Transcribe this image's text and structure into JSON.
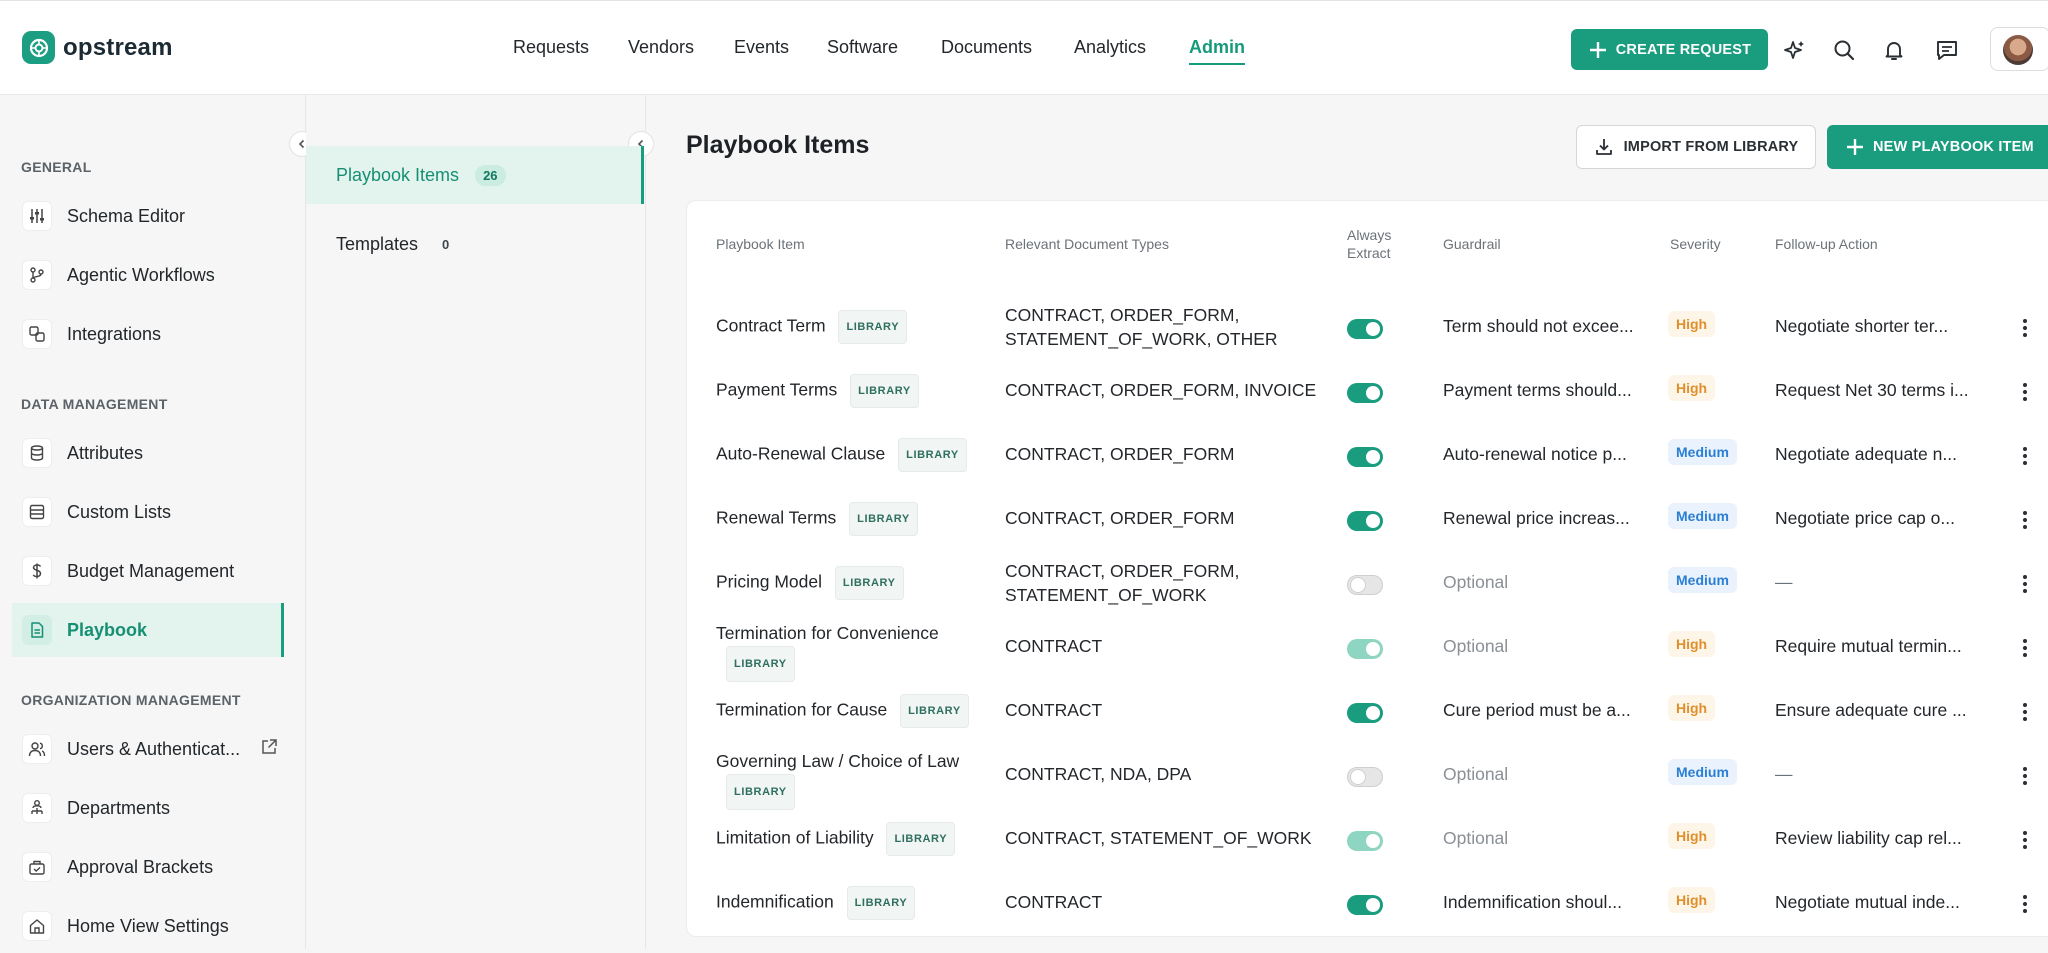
{
  "app": {
    "name": "opstream"
  },
  "nav": {
    "items": [
      "Requests",
      "Vendors",
      "Events",
      "Software",
      "Documents",
      "Analytics",
      "Admin"
    ],
    "active": "Admin"
  },
  "header": {
    "create_request": "CREATE REQUEST"
  },
  "sidebar": {
    "sections": [
      {
        "title": "GENERAL",
        "items": [
          {
            "label": "Schema Editor",
            "icon": "sliders-icon"
          },
          {
            "label": "Agentic Workflows",
            "icon": "branch-icon"
          },
          {
            "label": "Integrations",
            "icon": "integrations-icon"
          }
        ]
      },
      {
        "title": "DATA MANAGEMENT",
        "items": [
          {
            "label": "Attributes",
            "icon": "database-icon"
          },
          {
            "label": "Custom Lists",
            "icon": "list-icon"
          },
          {
            "label": "Budget Management",
            "icon": "dollar-icon"
          },
          {
            "label": "Playbook",
            "icon": "document-icon",
            "active": true
          }
        ]
      },
      {
        "title": "ORGANIZATION MANAGEMENT",
        "items": [
          {
            "label": "Users & Authenticat...",
            "icon": "users-icon",
            "external": true
          },
          {
            "label": "Departments",
            "icon": "org-chart-icon"
          },
          {
            "label": "Approval Brackets",
            "icon": "approval-icon"
          },
          {
            "label": "Home View Settings",
            "icon": "home-icon"
          }
        ]
      }
    ]
  },
  "subnav": {
    "items": [
      {
        "label": "Playbook Items",
        "count": "26",
        "active": true
      },
      {
        "label": "Templates",
        "count": "0"
      }
    ]
  },
  "main": {
    "title": "Playbook Items",
    "import_button": "IMPORT FROM LIBRARY",
    "new_button": "NEW PLAYBOOK ITEM"
  },
  "table": {
    "headers": {
      "item": "Playbook Item",
      "docs": "Relevant Document Types",
      "extract_1": "Always",
      "extract_2": "Extract",
      "guardrail": "Guardrail",
      "severity": "Severity",
      "followup": "Follow-up Action"
    },
    "library_badge": "LIBRARY",
    "rows": [
      {
        "name": "Contract Term",
        "docs": [
          "CONTRACT, ORDER_FORM,",
          "STATEMENT_OF_WORK, OTHER"
        ],
        "extract": "on",
        "guardrail": "Term should not excee...",
        "severity": "High",
        "followup": "Negotiate shorter ter..."
      },
      {
        "name": "Payment Terms",
        "docs": [
          "CONTRACT, ORDER_FORM, INVOICE"
        ],
        "extract": "on",
        "guardrail": "Payment terms should...",
        "severity": "High",
        "followup": "Request Net 30 terms i..."
      },
      {
        "name": "Auto-Renewal Clause",
        "docs": [
          "CONTRACT, ORDER_FORM"
        ],
        "extract": "on",
        "guardrail": "Auto-renewal notice p...",
        "severity": "Medium",
        "followup": "Negotiate adequate n..."
      },
      {
        "name": "Renewal Terms",
        "docs": [
          "CONTRACT, ORDER_FORM"
        ],
        "extract": "on",
        "guardrail": "Renewal price increas...",
        "severity": "Medium",
        "followup": "Negotiate price cap o..."
      },
      {
        "name": "Pricing Model",
        "docs": [
          "CONTRACT, ORDER_FORM,",
          "STATEMENT_OF_WORK"
        ],
        "extract": "off",
        "guardrail": "Optional",
        "severity": "Medium",
        "followup": "—"
      },
      {
        "name": "Termination for Convenience",
        "docs": [
          "CONTRACT"
        ],
        "extract": "on-light",
        "guardrail": "Optional",
        "severity": "High",
        "followup": "Require mutual termin..."
      },
      {
        "name": "Termination for Cause",
        "docs": [
          "CONTRACT"
        ],
        "extract": "on",
        "guardrail": "Cure period must be a...",
        "severity": "High",
        "followup": "Ensure adequate cure ..."
      },
      {
        "name": "Governing Law / Choice of Law",
        "docs": [
          "CONTRACT, NDA, DPA"
        ],
        "extract": "off",
        "guardrail": "Optional",
        "severity": "Medium",
        "followup": "—"
      },
      {
        "name": "Limitation of Liability",
        "docs": [
          "CONTRACT, STATEMENT_OF_WORK"
        ],
        "extract": "on-light",
        "guardrail": "Optional",
        "severity": "High",
        "followup": "Review liability cap rel..."
      },
      {
        "name": "Indemnification",
        "docs": [
          "CONTRACT"
        ],
        "extract": "on",
        "guardrail": "Indemnification shoul...",
        "severity": "High",
        "followup": "Negotiate mutual inde..."
      }
    ]
  },
  "colors": {
    "accent": "#1a9c7f",
    "high": "#e0902a",
    "medium": "#2a7fd4"
  }
}
